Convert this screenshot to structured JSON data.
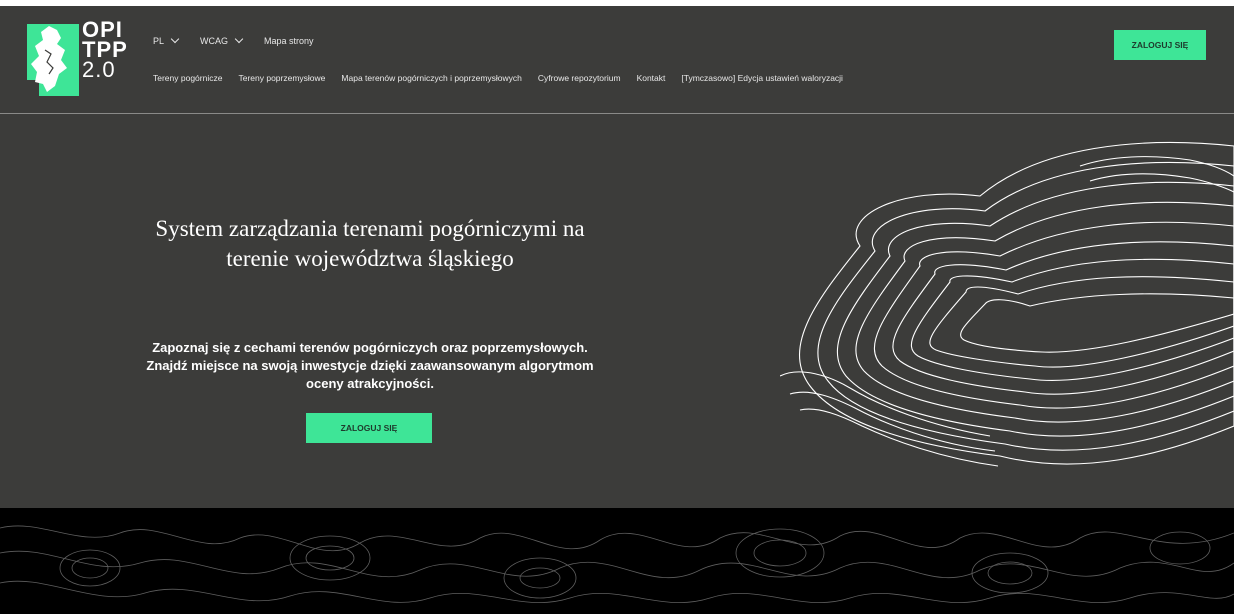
{
  "logo": {
    "line1": "OPI",
    "line2": "TPP",
    "line3": "2.0"
  },
  "topnav": {
    "language": "PL",
    "wcag": "WCAG",
    "sitemap": "Mapa strony"
  },
  "mainnav": [
    "Tereny pogórnicze",
    "Tereny poprzemysłowe",
    "Mapa terenów pogórniczych i poprzemysłowych",
    "Cyfrowe repozytorium",
    "Kontakt",
    "[Tymczasowo] Edycja ustawień waloryzacji"
  ],
  "header_login": "ZALOGUJ SIĘ",
  "hero": {
    "title": "System zarządzania terenami pogórniczymi na terenie województwa śląskiego",
    "subtitle": "Zapoznaj się z cechami terenów pogórniczych oraz poprzemysłowych. Znajdź miejsce na swoją inwestycje dzięki zaawansowanym algorytmom oceny atrakcyjności.",
    "button": "ZALOGUJ SIĘ"
  },
  "colors": {
    "accent": "#3ee597",
    "background": "#3c3c3a",
    "footer": "#000000"
  }
}
